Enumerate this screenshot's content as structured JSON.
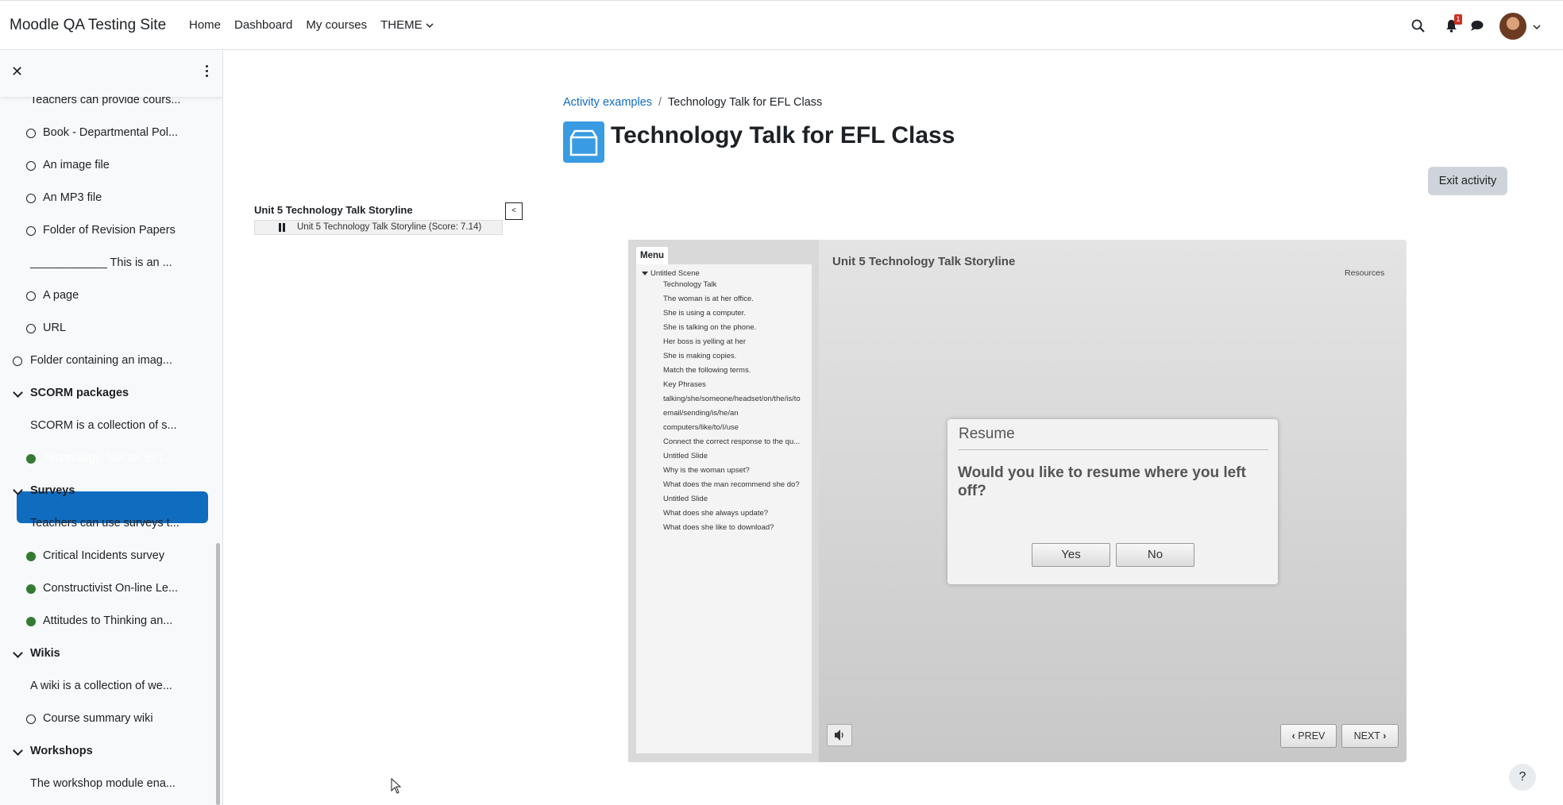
{
  "site": {
    "name": "Moodle QA Testing Site"
  },
  "nav": {
    "links": [
      "Home",
      "Dashboard",
      "My courses"
    ],
    "theme_label": "THEME",
    "notification_count": "1"
  },
  "drawer": {
    "items": [
      {
        "kind": "text",
        "label": "Teachers can provide cours..."
      },
      {
        "kind": "circle",
        "label": "Book - Departmental Pol..."
      },
      {
        "kind": "circle",
        "label": "An image file"
      },
      {
        "kind": "circle",
        "label": "An MP3 file"
      },
      {
        "kind": "circle",
        "label": "Folder of Revision Papers"
      },
      {
        "kind": "text",
        "label": "____________ This is an ..."
      },
      {
        "kind": "circle",
        "label": "A page"
      },
      {
        "kind": "circle",
        "label": "URL"
      },
      {
        "kind": "circle-outer",
        "label": "Folder containing an imag..."
      },
      {
        "kind": "section",
        "label": "SCORM packages"
      },
      {
        "kind": "text",
        "label": "SCORM is a collection of s..."
      },
      {
        "kind": "active",
        "label": "Technology Talk for EFL ..."
      },
      {
        "kind": "section",
        "label": "Surveys"
      },
      {
        "kind": "text",
        "label": "Teachers can use surveys t..."
      },
      {
        "kind": "dot",
        "label": "Critical Incidents survey"
      },
      {
        "kind": "dot",
        "label": "Constructivist On-line Le..."
      },
      {
        "kind": "dot",
        "label": "Attitudes to Thinking an..."
      },
      {
        "kind": "section",
        "label": "Wikis"
      },
      {
        "kind": "text",
        "label": "A wiki is a collection of we..."
      },
      {
        "kind": "circle",
        "label": "Course summary wiki"
      },
      {
        "kind": "section",
        "label": "Workshops"
      },
      {
        "kind": "text",
        "label": "The workshop module ena..."
      }
    ]
  },
  "breadcrumb": {
    "parent": "Activity examples",
    "separator": "/",
    "current": "Technology Talk for EFL Class"
  },
  "page": {
    "title": "Technology Talk for EFL Class",
    "exit_label": "Exit activity"
  },
  "toc": {
    "title": "Unit 5 Technology Talk Storyline",
    "collapse_label": "<",
    "entry": "Unit 5 Technology Talk Storyline (Score: 7.14)"
  },
  "player": {
    "menu_tab": "Menu",
    "scene": "Untitled Scene",
    "menu_items": [
      "Technology Talk",
      "The woman is at her office.",
      "She is using a computer.",
      "She is talking on the phone.",
      "Her boss is yelling at her",
      "She is making copies.",
      "Match the following terms.",
      "Key Phrases",
      "talking/she/someone/headset/on/the/is/to",
      "email/sending/is/he/an",
      "computers/like/to/I/use",
      "Connect the correct response to the qu...",
      "Untitled Slide",
      "Why is the woman upset?",
      "What does the man recommend she do?",
      "Untitled Slide",
      "What does she always update?",
      "What does she like to download?"
    ],
    "slide_title": "Unit 5 Technology Talk Storyline",
    "resources_label": "Resources",
    "dialog": {
      "title": "Resume",
      "message": "Would you like to resume where you left off?",
      "yes_label": "Yes",
      "no_label": "No"
    },
    "prev_label": "PREV",
    "next_label": "NEXT"
  },
  "help": {
    "label": "?"
  },
  "colors": {
    "brand": "#0f6cbf",
    "active_bg": "#0f6cbf",
    "complete_dot": "#357a32",
    "title_icon": "#399be2",
    "badge": "#ca3120"
  }
}
